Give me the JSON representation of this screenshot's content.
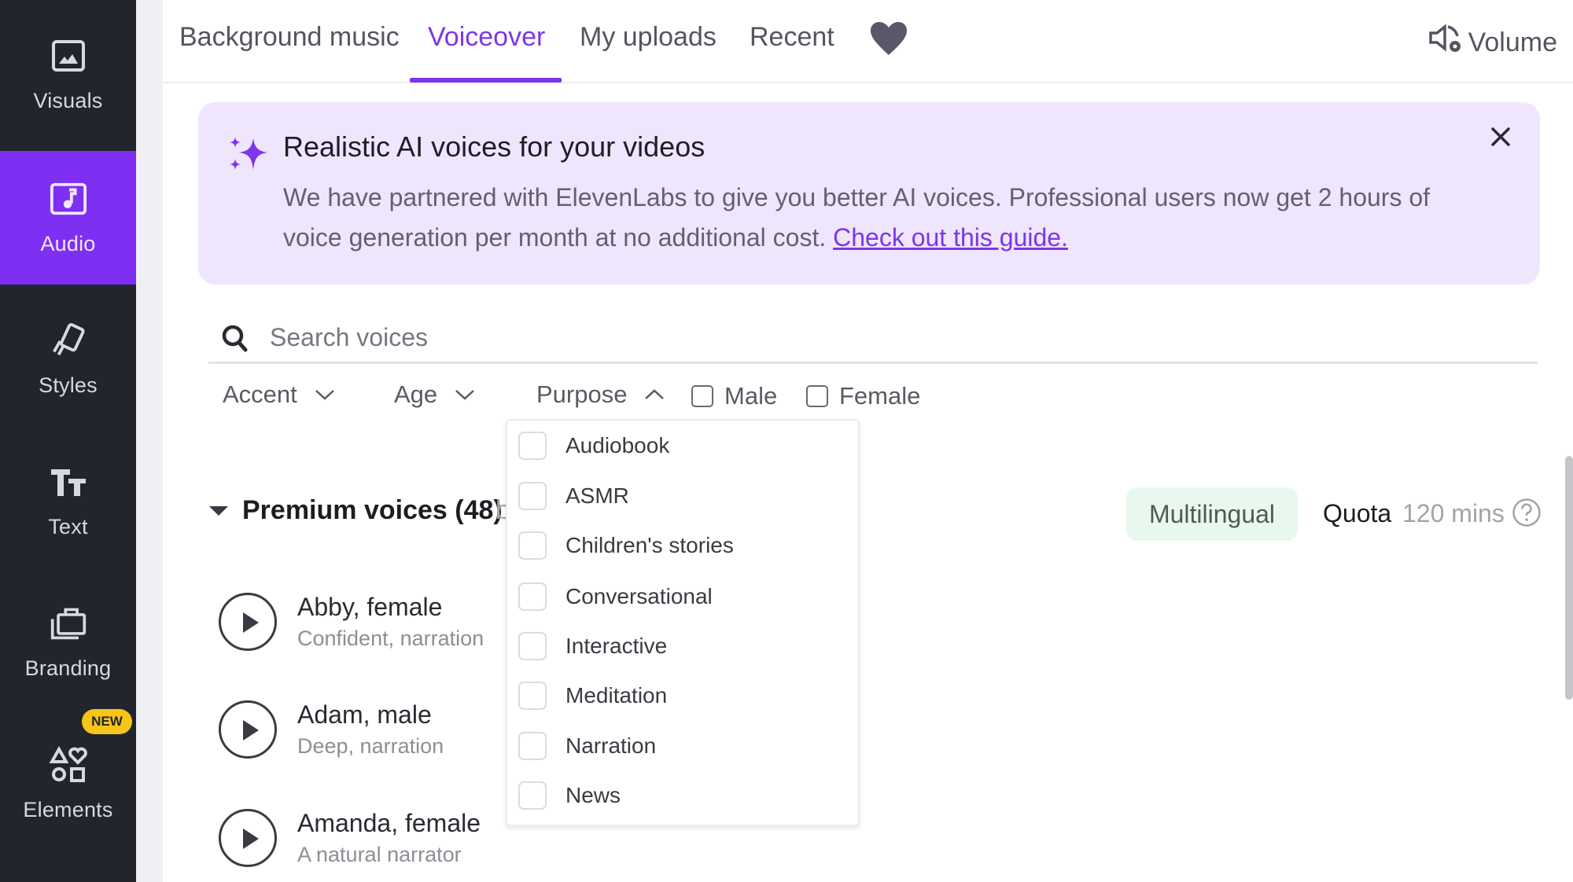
{
  "sidebar": {
    "items": [
      {
        "label": "Visuals",
        "icon": "image-icon",
        "active": false
      },
      {
        "label": "Audio",
        "icon": "music-note-icon",
        "active": true
      },
      {
        "label": "Styles",
        "icon": "styles-icon",
        "active": false
      },
      {
        "label": "Text",
        "icon": "text-icon",
        "active": false
      },
      {
        "label": "Branding",
        "icon": "briefcase-icon",
        "active": false
      },
      {
        "label": "Elements",
        "icon": "shapes-icon",
        "active": false,
        "badge": "NEW"
      }
    ]
  },
  "tabs": {
    "items": [
      {
        "label": "Background music",
        "active": false
      },
      {
        "label": "Voiceover",
        "active": true
      },
      {
        "label": "My uploads",
        "active": false
      },
      {
        "label": "Recent",
        "active": false
      }
    ],
    "favorites_icon": "heart-icon",
    "volume_label": "Volume"
  },
  "banner": {
    "title": "Realistic AI voices for your videos",
    "body": "We have partnered with ElevenLabs to give you better AI voices. Professional users now get 2 hours of voice generation per month at no additional cost.",
    "link": "Check out this guide."
  },
  "search": {
    "placeholder": "Search voices",
    "value": ""
  },
  "filters": {
    "accent": "Accent",
    "age": "Age",
    "purpose": "Purpose",
    "male": "Male",
    "female": "Female",
    "male_checked": false,
    "female_checked": false
  },
  "purpose_dropdown": {
    "open": true,
    "options": [
      "Audiobook",
      "ASMR",
      "Children's stories",
      "Conversational",
      "Interactive",
      "Meditation",
      "Narration",
      "News"
    ]
  },
  "premium": {
    "heading": "Premium voices (48)",
    "trailing": "b",
    "multilingual": "Multilingual",
    "quota_label": "Quota",
    "quota_value": "120 mins"
  },
  "voices": [
    {
      "name": "Abby, female",
      "desc": "Confident, narration"
    },
    {
      "name": "Adam, male",
      "desc": "Deep, narration"
    },
    {
      "name": "Amanda, female",
      "desc": "A natural narrator"
    }
  ],
  "colors": {
    "accent": "#7d36e8",
    "sidebar_bg": "#23252d",
    "sidebar_active": "#7d2ff2",
    "banner_bg": "#efe6fd",
    "badge": "#f5c518",
    "multilingual_bg": "#e8f8ef"
  }
}
